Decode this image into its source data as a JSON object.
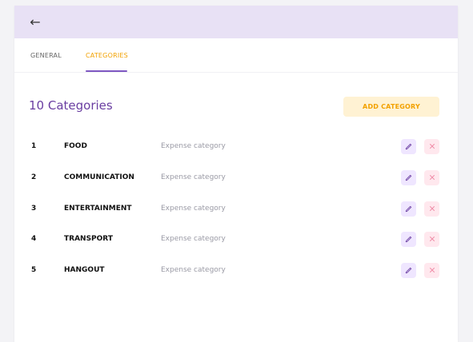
{
  "tabs": [
    {
      "label": "GENERAL"
    },
    {
      "label": "CATEGORIES",
      "active": true
    }
  ],
  "header": {
    "back_icon": "arrow-left-icon"
  },
  "main": {
    "title": "10 Categories",
    "add_button_label": "ADD CATEGORY",
    "rows": [
      {
        "index": "1",
        "name": "FOOD",
        "description": "Expense category"
      },
      {
        "index": "2",
        "name": "COMMUNICATION",
        "description": "Expense category"
      },
      {
        "index": "3",
        "name": "ENTERTAINMENT",
        "description": "Expense category"
      },
      {
        "index": "4",
        "name": "TRANSPORT",
        "description": "Expense category"
      },
      {
        "index": "5",
        "name": "HANGOUT",
        "description": "Expense category"
      }
    ]
  },
  "colors": {
    "accent_purple": "#6a3ea1",
    "accent_orange": "#f2a100",
    "header_bg": "#e8e1f5"
  },
  "icons": {
    "edit": "pencil-icon",
    "delete": "close-icon"
  }
}
